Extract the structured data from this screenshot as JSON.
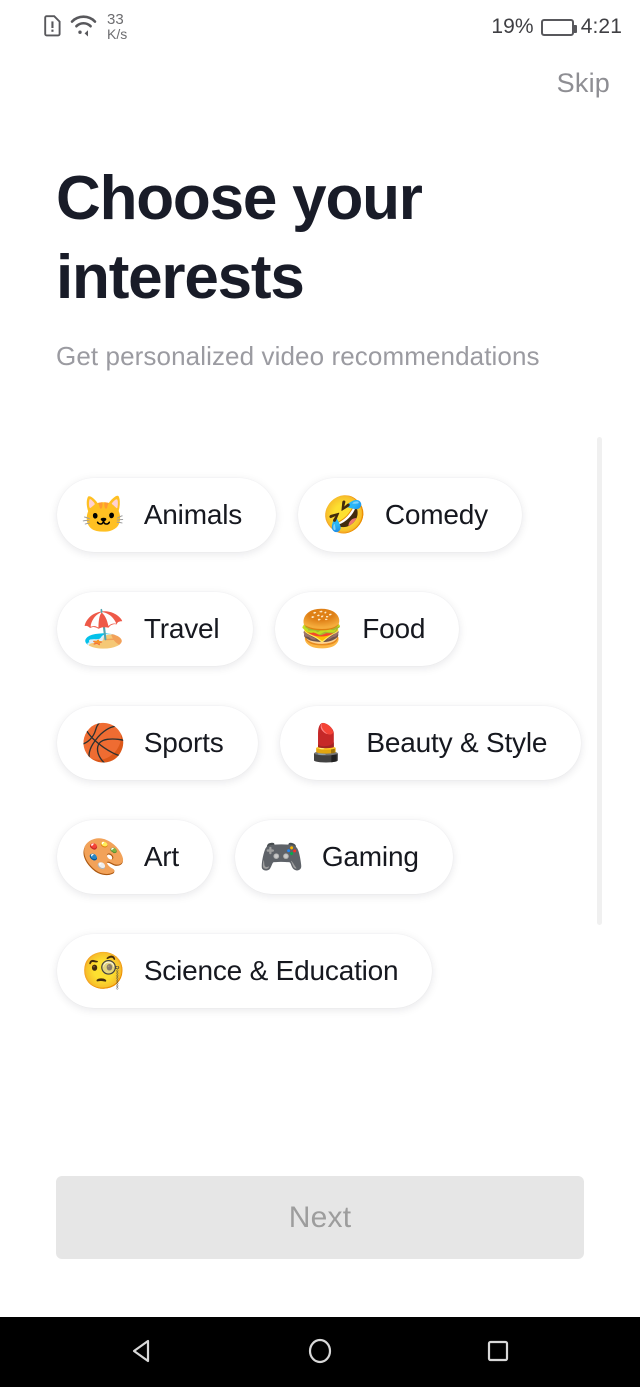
{
  "statusbar": {
    "sim_icon": "sim-alert-icon",
    "wifi_icon": "wifi-icon",
    "network_rate": "33",
    "network_unit": "K/s",
    "battery_percent": "19%",
    "battery_level": 19,
    "battery_color": "#f7941d",
    "clock": "4:21"
  },
  "header": {
    "skip_label": "Skip",
    "title": "Choose your interests",
    "subtitle": "Get personalized video recommendations",
    "title_color": "#191c28",
    "subtitle_color": "#9b9ba1"
  },
  "interests": {
    "chips": [
      {
        "label": "Animals",
        "emoji": "🐱",
        "icon_name": "cat-face-emoji",
        "selected": false
      },
      {
        "label": "Comedy",
        "emoji": "🤣",
        "icon_name": "rolling-on-floor-laughing-emoji",
        "selected": false
      },
      {
        "label": "Travel",
        "emoji": "🏖️",
        "icon_name": "beach-umbrella-emoji",
        "selected": false
      },
      {
        "label": "Food",
        "emoji": "🍔",
        "icon_name": "hamburger-emoji",
        "selected": false
      },
      {
        "label": "Sports",
        "emoji": "🏀",
        "icon_name": "basketball-emoji",
        "selected": false
      },
      {
        "label": "Beauty & Style",
        "emoji": "💄",
        "icon_name": "lipstick-emoji",
        "selected": false
      },
      {
        "label": "Art",
        "emoji": "🎨",
        "icon_name": "artist-palette-emoji",
        "selected": false
      },
      {
        "label": "Gaming",
        "emoji": "🎮",
        "icon_name": "video-game-controller-emoji",
        "selected": false
      },
      {
        "label": "Science & Education",
        "emoji": "🧐",
        "icon_name": "monocle-face-emoji",
        "selected": false
      }
    ]
  },
  "footer": {
    "next_label": "Next",
    "next_disabled": true,
    "next_bg": "#e6e6e6",
    "next_text_color": "#9d9d9d"
  },
  "navbar": {
    "back_label": "back-button",
    "home_label": "home-button",
    "recents_label": "recents-button"
  }
}
